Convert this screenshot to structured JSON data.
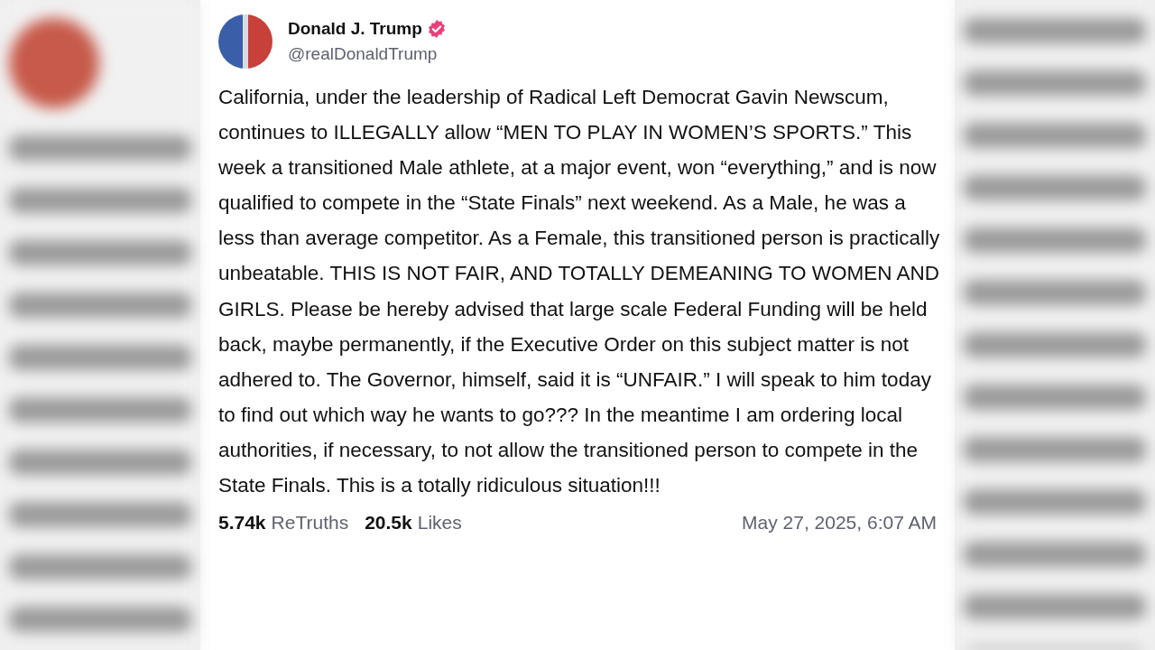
{
  "author": {
    "name": "Donald J. Trump",
    "verified": true,
    "handle": "@realDonaldTrump"
  },
  "post": {
    "text": "California, under the leadership of Radical Left Democrat Gavin Newscum, continues to ILLEGALLY allow “MEN TO PLAY IN WOMEN’S SPORTS.” This week a transitioned Male athlete, at a major event, won “everything,” and is now qualified to compete in the “State Finals” next weekend. As a Male, he was a less than average competitor. As a Female, this transitioned person is practically unbeatable. THIS IS NOT FAIR, AND TOTALLY DEMEANING TO WOMEN AND GIRLS. Please be hereby advised that large scale Federal Funding will be held back, maybe permanently, if the Executive Order on this subject matter is not adhered to. The Governor, himself, said it is “UNFAIR.” I will speak to him today to find out which way he wants to go??? In the meantime I am ordering local authorities, if necessary, to not allow the transitioned person to compete in the State Finals. This is a totally ridiculous situation!!!"
  },
  "stats": [
    {
      "count": "5.74k",
      "label": "ReTruths"
    },
    {
      "count": "20.5k",
      "label": "Likes"
    }
  ],
  "timestamp": "May 27, 2025, 6:07 AM"
}
